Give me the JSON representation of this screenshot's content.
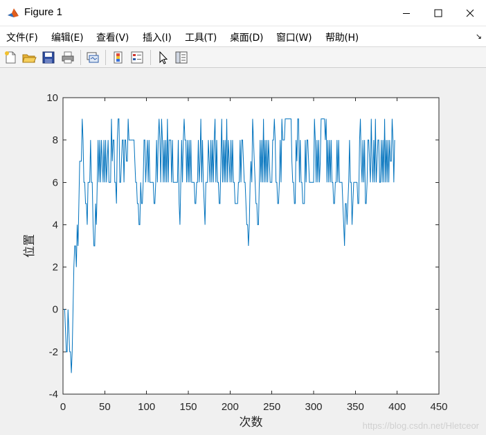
{
  "window": {
    "title": "Figure 1",
    "controls": {
      "minimize": "minimize",
      "maximize": "maximize",
      "close": "close"
    }
  },
  "menubar": {
    "items": [
      "文件(F)",
      "编辑(E)",
      "查看(V)",
      "插入(I)",
      "工具(T)",
      "桌面(D)",
      "窗口(W)",
      "帮助(H)"
    ],
    "dock_arrow": "↘"
  },
  "toolbar": {
    "icons": [
      "new-figure-icon",
      "open-file-icon",
      "save-icon",
      "print-icon",
      "link-figure-icon",
      "colorbar-icon",
      "legend-icon",
      "pointer-icon",
      "property-editor-icon"
    ]
  },
  "watermark": "https://blog.csdn.net/Hletceor",
  "colors": {
    "line": "#0072bd",
    "axes_bg": "#ffffff",
    "figure_bg": "#f0f0f0"
  },
  "chart_data": {
    "type": "line",
    "title": "",
    "xlabel": "次数",
    "ylabel": "位置",
    "xlim": [
      0,
      450
    ],
    "ylim": [
      -4,
      10
    ],
    "xticks": [
      0,
      50,
      100,
      150,
      200,
      250,
      300,
      350,
      400,
      450
    ],
    "yticks": [
      -4,
      -2,
      0,
      2,
      4,
      6,
      8,
      10
    ],
    "grid": false,
    "series": [
      {
        "values": [
          0,
          0,
          -1,
          -2,
          -2,
          0,
          -1,
          -2,
          -2,
          -3,
          -2,
          0,
          2,
          3,
          3,
          2,
          4,
          3,
          5,
          7,
          7,
          7,
          9,
          8,
          6,
          6,
          5,
          5,
          4,
          6,
          6,
          6,
          8,
          6,
          6,
          4,
          3,
          3,
          5,
          4,
          6,
          8,
          6,
          8,
          6,
          8,
          7,
          6,
          8,
          6,
          8,
          6,
          7,
          8,
          6,
          6,
          6,
          9,
          7,
          8,
          8,
          6,
          6,
          5,
          8,
          9,
          9,
          6,
          6,
          7,
          8,
          8,
          6,
          8,
          8,
          7,
          7,
          9,
          8,
          8,
          8,
          8,
          8,
          8,
          8,
          7,
          6,
          6,
          5,
          5,
          4,
          4,
          6,
          5,
          5,
          6,
          8,
          8,
          6,
          7,
          8,
          6,
          8,
          6,
          6,
          6,
          6,
          6,
          5,
          5,
          6,
          8,
          6,
          8,
          9,
          8,
          6,
          9,
          8,
          6,
          8,
          6,
          8,
          6,
          9,
          6,
          8,
          8,
          8,
          6,
          8,
          6,
          6,
          6,
          6,
          6,
          6,
          8,
          5,
          4,
          6,
          8,
          6,
          8,
          9,
          8,
          8,
          6,
          8,
          6,
          8,
          6,
          8,
          6,
          6,
          6,
          6,
          5,
          5,
          6,
          6,
          8,
          6,
          7,
          9,
          6,
          8,
          6,
          5,
          4,
          6,
          6,
          6,
          8,
          7,
          6,
          8,
          6,
          8,
          6,
          8,
          9,
          6,
          8,
          6,
          6,
          5,
          5,
          7,
          9,
          6,
          8,
          6,
          8,
          6,
          9,
          6,
          8,
          7,
          6,
          8,
          6,
          8,
          6,
          6,
          5,
          5,
          5,
          5,
          6,
          6,
          8,
          6,
          8,
          8,
          7,
          6,
          6,
          5,
          4,
          4,
          3,
          4,
          6,
          7,
          6,
          9,
          8,
          7,
          6,
          5,
          5,
          4,
          4,
          6,
          8,
          6,
          8,
          6,
          9,
          6,
          8,
          6,
          8,
          6,
          8,
          7,
          6,
          6,
          6,
          8,
          8,
          9,
          8,
          6,
          6,
          5,
          5,
          6,
          8,
          6,
          9,
          8,
          8,
          8,
          9,
          9,
          9,
          9,
          9,
          9,
          9,
          9,
          7,
          6,
          6,
          5,
          5,
          8,
          7,
          9,
          9,
          6,
          8,
          6,
          6,
          5,
          5,
          5,
          8,
          6,
          8,
          8,
          7,
          6,
          6,
          6,
          6,
          6,
          6,
          9,
          8,
          6,
          8,
          6,
          8,
          6,
          7,
          9,
          9,
          9,
          9,
          9,
          8,
          9,
          6,
          8,
          6,
          8,
          6,
          8,
          6,
          6,
          5,
          5,
          6,
          6,
          8,
          6,
          8,
          6,
          6,
          6,
          6,
          5,
          4,
          3,
          5,
          5,
          4,
          5,
          6,
          8,
          6,
          6,
          4,
          5,
          6,
          6,
          6,
          6,
          6,
          5,
          5,
          8,
          9,
          7,
          6,
          8,
          6,
          8,
          5,
          5,
          6,
          8,
          8,
          7,
          6,
          9,
          7,
          6,
          8,
          6,
          9,
          6,
          7,
          8,
          8,
          6,
          6,
          8,
          6,
          8,
          6,
          9,
          6,
          8,
          6,
          8,
          6,
          8,
          7,
          7,
          9,
          8,
          6,
          8
        ]
      }
    ]
  }
}
